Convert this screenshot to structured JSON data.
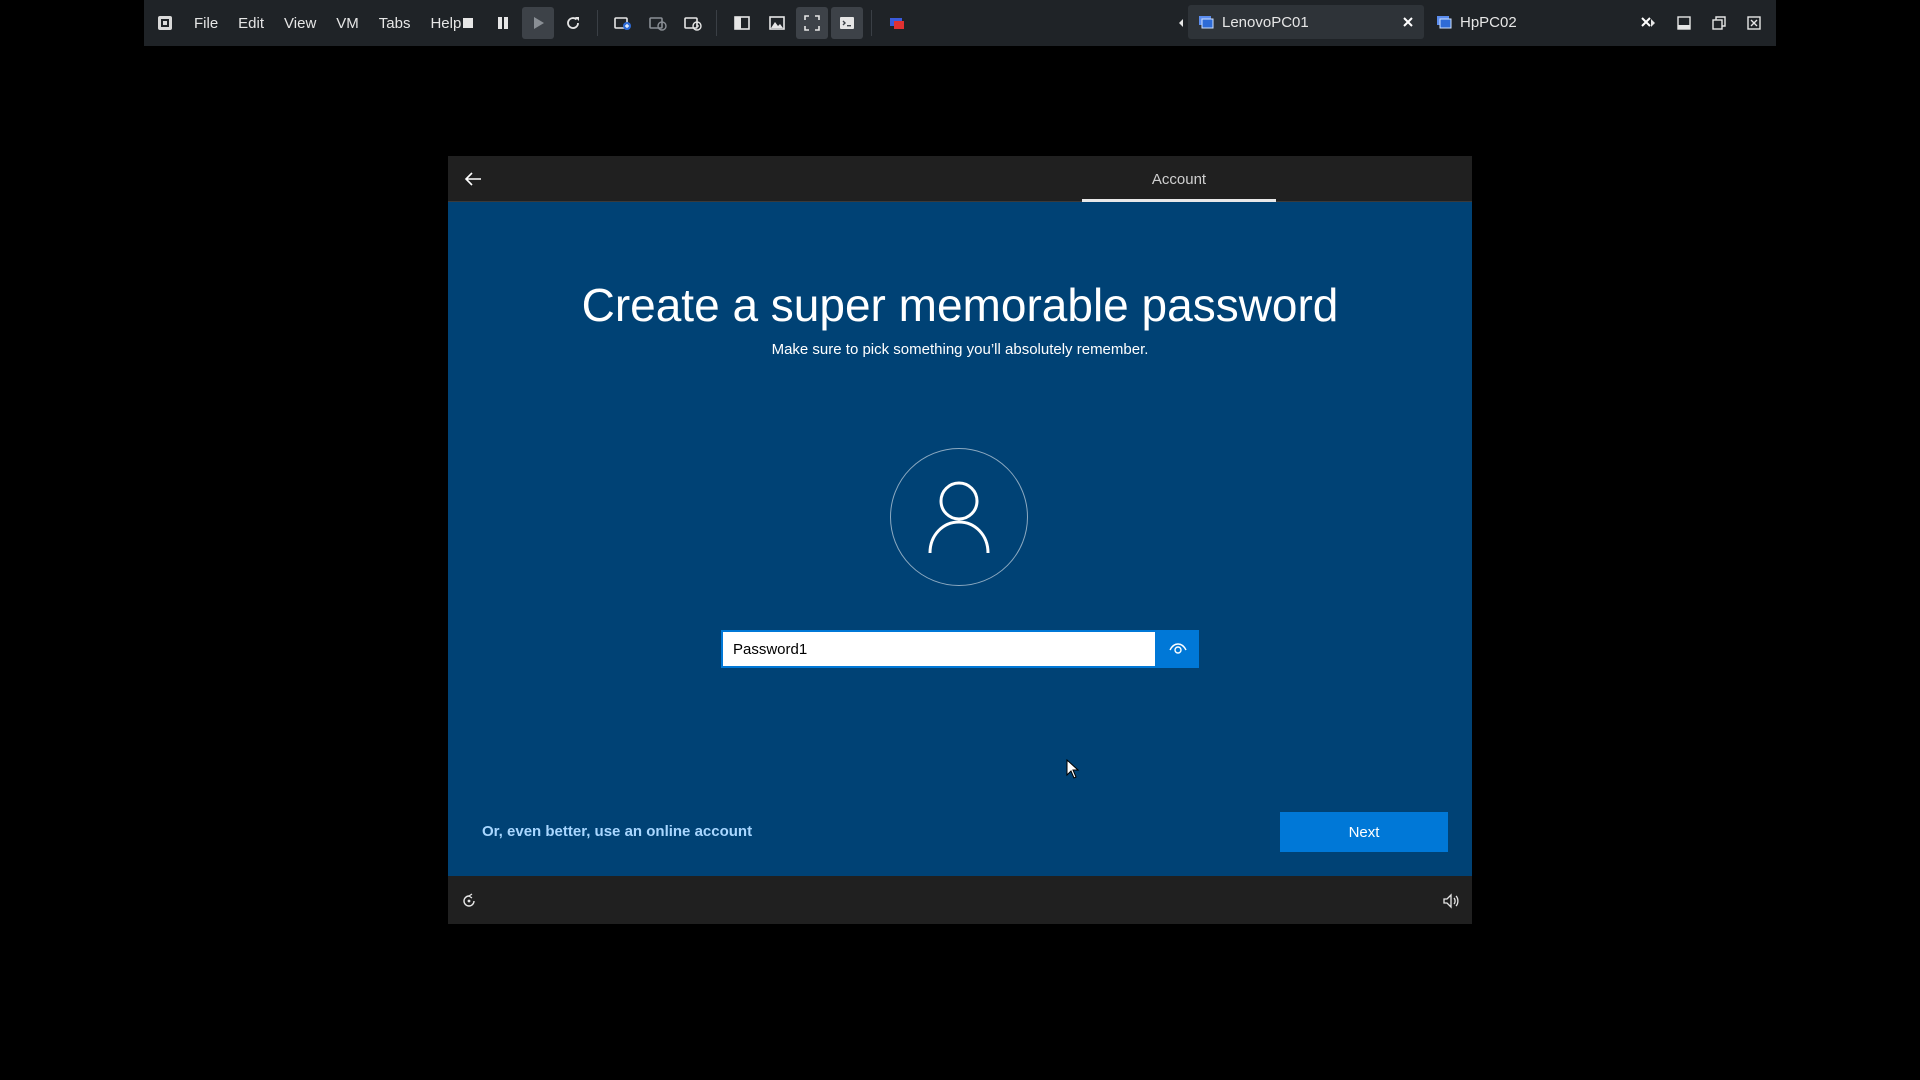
{
  "toolbar": {
    "menu": [
      "File",
      "Edit",
      "View",
      "VM",
      "Tabs",
      "Help"
    ],
    "tabs": [
      {
        "label": "LenovoPC01",
        "active": true
      },
      {
        "label": "HpPC02",
        "active": false
      }
    ],
    "accent": "#2e6bd6"
  },
  "guest": {
    "step_tab": "Account",
    "title": "Create a super memorable password",
    "subtitle": "Make sure to pick something you’ll absolutely remember.",
    "password_value": "Password1",
    "online_link": "Or, even better, use an online account",
    "next_label": "Next",
    "background_color": "#004275",
    "button_color": "#0078d7"
  }
}
